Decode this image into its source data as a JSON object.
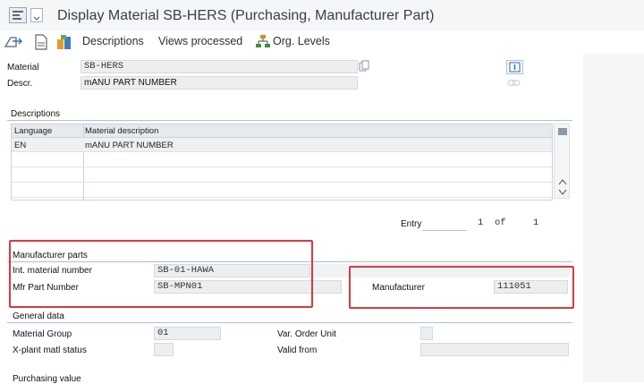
{
  "window": {
    "title": "Display Material SB-HERS (Purchasing, Manufacturer Part)"
  },
  "toolbar": {
    "descriptions_label": "Descriptions",
    "views_processed_label": "Views processed",
    "org_levels_label": "Org. Levels"
  },
  "header": {
    "material_label": "Material",
    "material_value": "SB-HERS",
    "descr_label": "Descr.",
    "descr_value": "mANU PART NUMBER"
  },
  "descriptions": {
    "section_title": "Descriptions",
    "columns": [
      "Language",
      "Material description"
    ],
    "rows": [
      {
        "language": "EN",
        "description": "mANU PART NUMBER"
      }
    ],
    "entry_label": "Entry",
    "entry_current": "1",
    "entry_of_label": "of",
    "entry_total": "1"
  },
  "manufacturer_parts": {
    "section_title": "Manufacturer parts",
    "int_material_label": "Int. material number",
    "int_material_value": "SB-01-HAWA",
    "mfr_part_label": "Mfr Part Number",
    "mfr_part_value": "SB-MPN01",
    "manufacturer_label": "Manufacturer",
    "manufacturer_value": "111051"
  },
  "general_data": {
    "section_title": "General data",
    "material_group_label": "Material Group",
    "material_group_value": "01",
    "xplant_status_label": "X-plant matl status",
    "xplant_status_value": "",
    "var_order_unit_label": "Var. Order Unit",
    "var_order_unit_value": "",
    "valid_from_label": "Valid from",
    "valid_from_value": ""
  },
  "purchasing_values": {
    "section_title": "Purchasing value"
  },
  "colors": {
    "highlight_red": "#d9393f",
    "section_line": "#a9c3d8",
    "field_bg": "#eceef0"
  }
}
